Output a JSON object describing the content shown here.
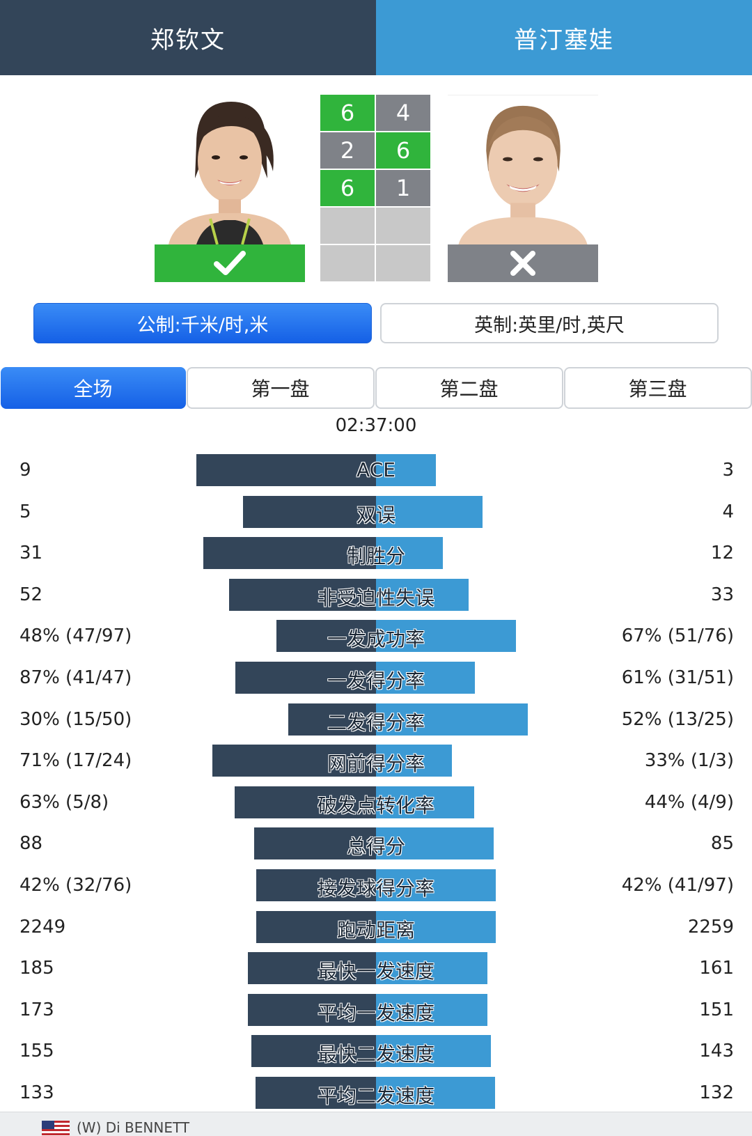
{
  "header": {
    "player_left": "郑钦文",
    "player_right": "普汀塞娃"
  },
  "players": {
    "left": {
      "result_icon": "check-icon",
      "result_color": "#30b43c"
    },
    "right": {
      "result_icon": "close-icon",
      "result_color": "#7f8288"
    }
  },
  "sets": [
    {
      "left": "6",
      "right": "4",
      "winner": "left"
    },
    {
      "left": "2",
      "right": "6",
      "winner": "right"
    },
    {
      "left": "6",
      "right": "1",
      "winner": "left"
    },
    {
      "left": "",
      "right": "",
      "winner": "none"
    },
    {
      "left": "",
      "right": "",
      "winner": "none"
    }
  ],
  "units": {
    "metric": "公制:千米/时,米",
    "imperial": "英制:英里/时,英尺",
    "selected": "metric"
  },
  "tabs": [
    {
      "label": "全场",
      "active": true
    },
    {
      "label": "第一盘",
      "active": false
    },
    {
      "label": "第二盘",
      "active": false
    },
    {
      "label": "第三盘",
      "active": false
    }
  ],
  "duration": "02:37:00",
  "stats": [
    {
      "label": "ACE",
      "left": "9",
      "right": "3",
      "left_ratio": 0.75,
      "right_ratio": 0.25
    },
    {
      "label": "双误",
      "left": "5",
      "right": "4",
      "left_ratio": 0.556,
      "right_ratio": 0.444
    },
    {
      "label": "制胜分",
      "left": "31",
      "right": "12",
      "left_ratio": 0.721,
      "right_ratio": 0.279
    },
    {
      "label": "非受迫性失误",
      "left": "52",
      "right": "33",
      "left_ratio": 0.612,
      "right_ratio": 0.388
    },
    {
      "label": "一发成功率",
      "left": "48% (47/97)",
      "right": "67% (51/76)",
      "left_ratio": 0.417,
      "right_ratio": 0.583
    },
    {
      "label": "一发得分率",
      "left": "87% (41/47)",
      "right": "61% (31/51)",
      "left_ratio": 0.588,
      "right_ratio": 0.412
    },
    {
      "label": "二发得分率",
      "left": "30% (15/50)",
      "right": "52% (13/25)",
      "left_ratio": 0.366,
      "right_ratio": 0.634
    },
    {
      "label": "网前得分率",
      "left": "71% (17/24)",
      "right": "33% (1/3)",
      "left_ratio": 0.683,
      "right_ratio": 0.317
    },
    {
      "label": "破发点转化率",
      "left": "63% (5/8)",
      "right": "44% (4/9)",
      "left_ratio": 0.589,
      "right_ratio": 0.411
    },
    {
      "label": "总得分",
      "left": "88",
      "right": "85",
      "left_ratio": 0.509,
      "right_ratio": 0.491
    },
    {
      "label": "接发球得分率",
      "left": "42% (32/76)",
      "right": "42% (41/97)",
      "left_ratio": 0.5,
      "right_ratio": 0.5
    },
    {
      "label": "跑动距离",
      "left": "2249",
      "right": "2259",
      "left_ratio": 0.499,
      "right_ratio": 0.501
    },
    {
      "label": "最快一发速度",
      "left": "185",
      "right": "161",
      "left_ratio": 0.535,
      "right_ratio": 0.465
    },
    {
      "label": "平均一发速度",
      "left": "173",
      "right": "151",
      "left_ratio": 0.534,
      "right_ratio": 0.466
    },
    {
      "label": "最快二发速度",
      "left": "155",
      "right": "143",
      "left_ratio": 0.52,
      "right_ratio": 0.48
    },
    {
      "label": "平均二发速度",
      "left": "133",
      "right": "132",
      "left_ratio": 0.502,
      "right_ratio": 0.498
    }
  ],
  "bottom": {
    "text": "(W) Di BENNETT"
  },
  "colors": {
    "left_dark": "#334559",
    "right_blue": "#3c9ad4",
    "win_green": "#30b43c",
    "lose_gray": "#7f8288",
    "accent_blue": "#1a66e8"
  }
}
